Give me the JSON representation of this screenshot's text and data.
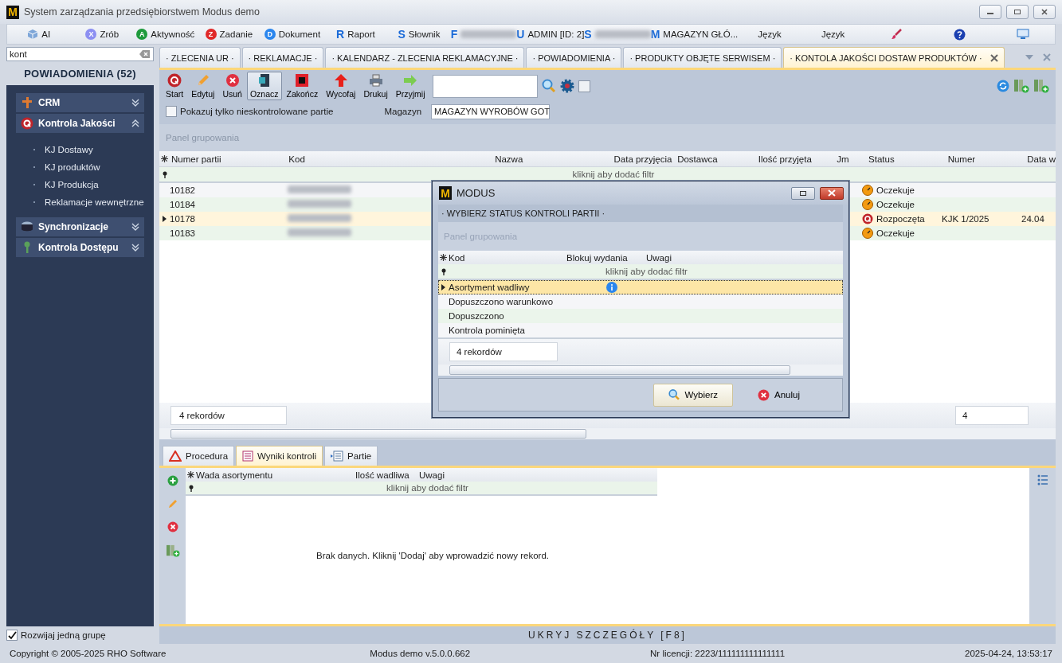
{
  "window": {
    "logo": "M",
    "title": "System zarządzania przedsiębiorstwem Modus demo"
  },
  "menubar": [
    {
      "kind": "ai",
      "label": "AI"
    },
    {
      "kind": "circle",
      "badge": "X",
      "color": "#8c8ff2",
      "label": "Zrób"
    },
    {
      "kind": "circle",
      "badge": "A",
      "color": "#1e9a3c",
      "label": "Aktywność"
    },
    {
      "kind": "circle",
      "badge": "Z",
      "color": "#e02828",
      "label": "Zadanie"
    },
    {
      "kind": "circle",
      "badge": "D",
      "color": "#2a86ee",
      "label": "Dokument"
    },
    {
      "kind": "letter",
      "badge": "R",
      "label": "Raport"
    },
    {
      "kind": "letter",
      "badge": "S",
      "label": "Słownik"
    },
    {
      "kind": "letter",
      "badge": "F",
      "redacted": true
    },
    {
      "kind": "letter",
      "badge": "U",
      "label": "ADMIN [ID: 2]"
    },
    {
      "kind": "letter",
      "badge": "S",
      "redacted": true
    },
    {
      "kind": "letter",
      "badge": "M",
      "label": "MAGAZYN GŁÓ..."
    },
    {
      "kind": "text",
      "label": "Język"
    },
    {
      "kind": "text",
      "label": "Język"
    },
    {
      "kind": "brush"
    },
    {
      "kind": "help"
    },
    {
      "kind": "screen"
    }
  ],
  "sidebar": {
    "search": {
      "value": "kont"
    },
    "title": "POWIADOMIENIA (52)",
    "groups": [
      {
        "kind": "crm",
        "label": "CRM",
        "expanded": false
      },
      {
        "kind": "quality",
        "label": "Kontrola Jakości",
        "expanded": true,
        "children": [
          {
            "label": "KJ Dostawy"
          },
          {
            "label": "KJ produktów"
          },
          {
            "label": "KJ Produkcja"
          },
          {
            "label": "Reklamacje wewnętrzne"
          }
        ]
      },
      {
        "kind": "sync",
        "label": "Synchronizacje",
        "expanded": false
      },
      {
        "kind": "access",
        "label": "Kontrola Dostępu",
        "expanded": false
      }
    ],
    "expand_one": {
      "label": "Rozwijaj jedną grupę",
      "checked": true
    }
  },
  "tabs": [
    {
      "label": "· ZLECENIA UR ·",
      "selected": false
    },
    {
      "label": "· REKLAMACJE ·",
      "selected": false
    },
    {
      "label": "· KALENDARZ - ZLECENIA REKLAMACYJNE ·",
      "selected": false
    },
    {
      "label": "· POWIADOMIENIA ·",
      "selected": false
    },
    {
      "label": "· PRODUKTY OBJĘTE SERWISEM ·",
      "selected": false
    },
    {
      "label": "· KONTOLA JAKOŚCI DOSTAW PRODUKTÓW ·",
      "selected": true
    }
  ],
  "toolbar": [
    {
      "kind": "start",
      "label": "Start",
      "pressed": false
    },
    {
      "kind": "edit",
      "label": "Edytuj",
      "pressed": false
    },
    {
      "kind": "delete",
      "label": "Usuń",
      "pressed": false
    },
    {
      "kind": "mark",
      "label": "Oznacz",
      "pressed": true
    },
    {
      "kind": "finish",
      "label": "Zakończ",
      "pressed": false
    },
    {
      "kind": "revert",
      "label": "Wycofaj",
      "pressed": false
    },
    {
      "kind": "print",
      "label": "Drukuj",
      "pressed": false
    },
    {
      "kind": "accept",
      "label": "Przyjmij",
      "pressed": false
    }
  ],
  "toolbar_option": {
    "checked": false
  },
  "filters": {
    "only_unchecked": {
      "label": "Pokazuj tylko nieskontrolowane partie",
      "checked": false
    },
    "warehouse": {
      "label": "Magazyn",
      "value": "MAGAZYN WYROBÓW GOT"
    }
  },
  "grid": {
    "group_panel": "Panel grupowania",
    "columns": [
      "Numer partii",
      "Kod",
      "Nazwa",
      "Data przyjęcia",
      "Dostawca",
      "Ilość przyjęta",
      "Jm",
      "Status",
      "Numer",
      "Data w"
    ],
    "filter_hint": "kliknij aby dodać filtr",
    "rows": [
      {
        "numer_partii": "10182",
        "status": "Oczekuje",
        "kind": "waiting",
        "selected": false
      },
      {
        "numer_partii": "10184",
        "status": "Oczekuje",
        "kind": "waiting",
        "selected": false
      },
      {
        "numer_partii": "10178",
        "status": "Rozpoczęta",
        "kind": "started",
        "numer": "KJK 1/2025",
        "data": "24.04",
        "selected": true
      },
      {
        "numer_partii": "10183",
        "status": "Oczekuje",
        "kind": "waiting",
        "selected": false
      }
    ],
    "record_count": "4 rekordów",
    "summary": "4"
  },
  "details": {
    "tabs": [
      {
        "kind": "procedure",
        "label": "Procedura",
        "selected": false
      },
      {
        "kind": "results",
        "label": "Wyniki kontroli",
        "selected": true
      },
      {
        "kind": "batches",
        "label": "Partie",
        "selected": false
      }
    ],
    "columns": [
      "Wada asortymentu",
      "Ilość wadliwa",
      "Uwagi"
    ],
    "filter_hint": "kliknij aby dodać filtr",
    "empty_message": "Brak danych. Kliknij 'Dodaj' aby wprowadzić nowy rekord.",
    "hide_label": "UKRYJ SZCZEGÓŁY [F8]"
  },
  "status_bar": [
    "Copyright © 2005-2025 RHO Software",
    "Modus demo v.5.0.0.662",
    "Nr licencji: 2223/111111111111111",
    "2025-04-24, 13:53:17"
  ],
  "dialog": {
    "logo": "M",
    "title": "MODUS",
    "section": "· WYBIERZ STATUS KONTROLI PARTII ·",
    "group_panel": "Panel grupowania",
    "columns": [
      "Kod",
      "Blokuj wydania",
      "Uwagi"
    ],
    "filter_hint": "kliknij aby dodać filtr",
    "rows": [
      {
        "kod": "Asortyment wadliwy",
        "info": true,
        "selected": true
      },
      {
        "kod": "Dopuszczono warunkowo",
        "info": false,
        "selected": false
      },
      {
        "kod": "Dopuszczono",
        "info": false,
        "selected": false
      },
      {
        "kod": "Kontrola pominięta",
        "info": false,
        "selected": false
      }
    ],
    "record_count": "4 rekordów",
    "buttons": [
      {
        "kind": "select",
        "label": "Wybierz"
      },
      {
        "kind": "cancel",
        "label": "Anuluj"
      }
    ]
  }
}
